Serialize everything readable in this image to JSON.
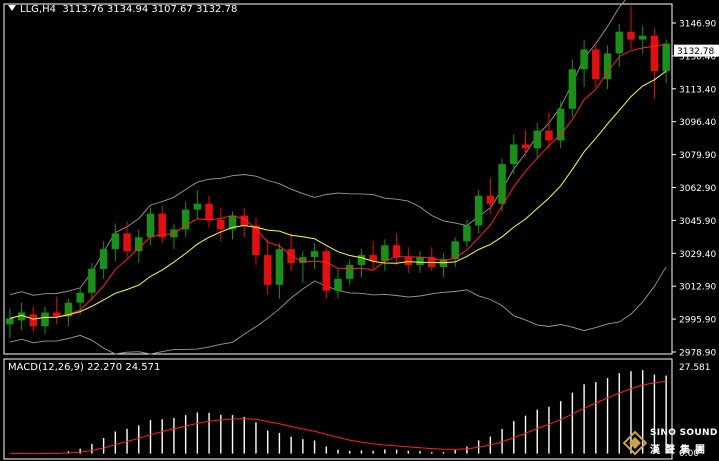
{
  "header": {
    "symbol_label": "LLG,H4",
    "open": "3113.76",
    "high": "3134.94",
    "low": "3107.67",
    "close": "3132.78"
  },
  "price_axis": {
    "ticks": [
      "3146.90",
      "3130.40",
      "3113.40",
      "3096.40",
      "3079.90",
      "3062.90",
      "3045.90",
      "3029.40",
      "3012.90",
      "2995.90",
      "2978.90"
    ],
    "current_price": "3132.78"
  },
  "macd": {
    "label": "MACD(12,26,9)",
    "macd_value": "22.270",
    "signal_value": "24.571",
    "axis_ticks": [
      "27.581",
      "0.00"
    ]
  },
  "logo": {
    "line1": "SINO SOUND",
    "line2": "漢聲集團",
    "line3": "HOLDINGS"
  },
  "colors": {
    "background": "#000000",
    "bull_candle": "#1a8f1a",
    "bear_candle": "#e01010",
    "upper_band": "#9a9a9a",
    "fast_ma": "#ff2020",
    "slow_ma": "#ffff33",
    "macd_hist": "#ffffff",
    "signal_line": "#ff2020"
  },
  "chart_data": {
    "type": "candlestick",
    "ylim": [
      2975,
      3152
    ],
    "candles": [
      [
        2990,
        2998,
        2983,
        2993
      ],
      [
        2992,
        3001,
        2987,
        2996
      ],
      [
        2995,
        2999,
        2986,
        2989
      ],
      [
        2989,
        2999,
        2985,
        2996
      ],
      [
        2996,
        3004,
        2990,
        2994
      ],
      [
        2994,
        3003,
        2989,
        3001
      ],
      [
        3001,
        3009,
        2995,
        3006
      ],
      [
        3006,
        3021,
        3002,
        3018
      ],
      [
        3018,
        3032,
        3013,
        3028
      ],
      [
        3028,
        3041,
        3022,
        3036
      ],
      [
        3036,
        3042,
        3024,
        3027
      ],
      [
        3027,
        3038,
        3021,
        3034
      ],
      [
        3034,
        3049,
        3030,
        3046
      ],
      [
        3046,
        3050,
        3031,
        3034
      ],
      [
        3034,
        3041,
        3028,
        3038
      ],
      [
        3038,
        3052,
        3034,
        3048
      ],
      [
        3048,
        3058,
        3043,
        3051
      ],
      [
        3051,
        3055,
        3039,
        3043
      ],
      [
        3043,
        3049,
        3032,
        3038
      ],
      [
        3038,
        3047,
        3033,
        3045
      ],
      [
        3045,
        3049,
        3034,
        3040
      ],
      [
        3040,
        3044,
        3020,
        3025
      ],
      [
        3025,
        3033,
        3005,
        3010
      ],
      [
        3010,
        3031,
        3003,
        3028
      ],
      [
        3028,
        3036,
        3017,
        3021
      ],
      [
        3021,
        3027,
        3011,
        3024
      ],
      [
        3024,
        3031,
        3018,
        3027
      ],
      [
        3027,
        3029,
        3003,
        3007
      ],
      [
        3007,
        3018,
        3003,
        3013
      ],
      [
        3013,
        3023,
        3010,
        3020
      ],
      [
        3020,
        3028,
        3014,
        3025
      ],
      [
        3025,
        3032,
        3018,
        3022
      ],
      [
        3022,
        3033,
        3017,
        3030
      ],
      [
        3030,
        3036,
        3020,
        3024
      ],
      [
        3024,
        3029,
        3016,
        3020
      ],
      [
        3020,
        3027,
        3016,
        3024
      ],
      [
        3024,
        3029,
        3017,
        3019
      ],
      [
        3019,
        3026,
        3014,
        3023
      ],
      [
        3023,
        3034,
        3019,
        3032
      ],
      [
        3032,
        3043,
        3029,
        3040
      ],
      [
        3040,
        3058,
        3036,
        3055
      ],
      [
        3055,
        3064,
        3046,
        3051
      ],
      [
        3051,
        3074,
        3047,
        3071
      ],
      [
        3071,
        3086,
        3066,
        3081
      ],
      [
        3081,
        3088,
        3075,
        3079
      ],
      [
        3079,
        3092,
        3074,
        3088
      ],
      [
        3088,
        3097,
        3079,
        3083
      ],
      [
        3083,
        3103,
        3079,
        3099
      ],
      [
        3099,
        3124,
        3095,
        3119
      ],
      [
        3119,
        3134,
        3110,
        3129
      ],
      [
        3129,
        3133,
        3110,
        3114
      ],
      [
        3114,
        3131,
        3109,
        3127
      ],
      [
        3127,
        3142,
        3120,
        3138
      ],
      [
        3138,
        3151,
        3129,
        3134
      ],
      [
        3134,
        3141,
        3127,
        3136
      ],
      [
        3136,
        3140,
        3104,
        3118
      ],
      [
        3118,
        3134,
        3112,
        3132
      ]
    ]
  }
}
